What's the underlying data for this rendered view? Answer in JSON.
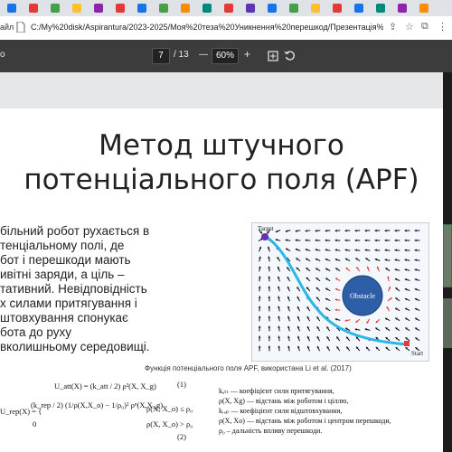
{
  "browser": {
    "address_prefix": "айл",
    "url": "C:/My%20disk/Aspirantura/2023-2025/Моя%20теза%20Уникнення%20перешкод/Презентація%20...",
    "tab_colors": [
      "#1a73e8",
      "#e53935",
      "#43a047",
      "#fbc02d",
      "#8e24aa",
      "#e53935",
      "#1a73e8",
      "#43a047",
      "#fb8c00",
      "#00897b",
      "#e53935",
      "#5e35b1",
      "#1a73e8",
      "#43a047",
      "#fbc02d",
      "#e53935",
      "#1a73e8",
      "#00897b",
      "#8e24aa",
      "#fb8c00"
    ]
  },
  "pdf_toolbar": {
    "left_label": "о",
    "current_page": "7",
    "page_total": "/ 13",
    "zoom_out": "—",
    "zoom": "60%",
    "zoom_in": "+"
  },
  "slide": {
    "title_line1": "Метод штучного",
    "title_line2": "потенціального поля (APF)",
    "body_lines": [
      "більний робот рухається в",
      "тенціальному полі, де",
      "бот і перешкоди мають",
      "ивітні заряди, а ціль –",
      "тативний. Невідповідність",
      "х силами притягування і",
      "штовхування спонукає",
      "бота до руху",
      "вколишньому середовищі."
    ],
    "figure": {
      "target_label": "Target",
      "obstacle_label": "Obstacle",
      "start_label": "Start"
    },
    "caption": "Функція потенціального поля APF, використана Li et al. (2017)",
    "formula1": "U_att(X) = (k_att / 2) ρ²(X, X_g)",
    "formula1_number": "(1)",
    "formula2_prefix": "U_rep(X) = {",
    "formula2_case1": "(k_rep / 2) (1/ρ(X,X_o) − 1/ρ₀)² ρⁿ(X,X_g)",
    "formula2_cond1": "ρ(X, X_o) ≤ ρ₀",
    "formula2_case2": "0",
    "formula2_cond2": "ρ(X, X_o) > ρ₀",
    "formula2_number": "(2)",
    "legend": [
      "kₐₜₜ — коефіцієнт сили притягування,",
      "ρ(X, Xg) — відстань між роботом і ціллю,",
      "kᵣₑₚ — коефіцієнт сили відштовхування,",
      "ρ(X, Xo) — відстань між роботом і центром перешкоди,",
      "ρ₀ – дальність впливу перешкоди."
    ]
  }
}
